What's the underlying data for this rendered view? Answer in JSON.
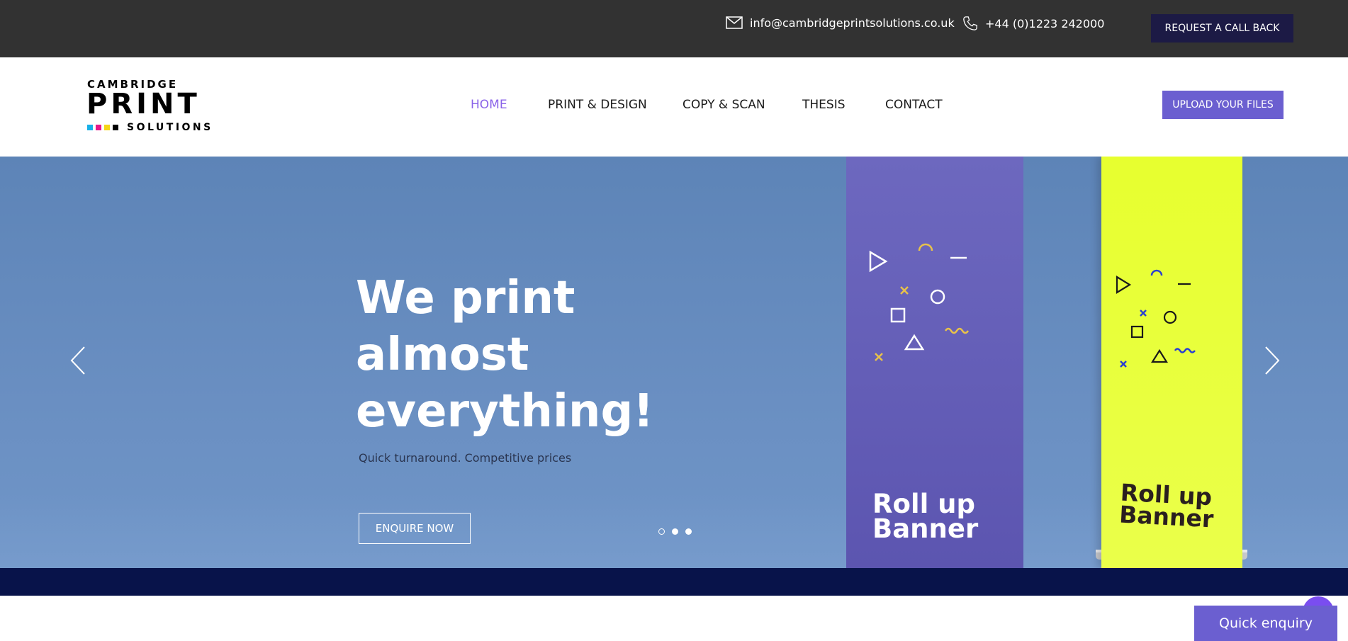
{
  "topbar": {
    "email": "info@cambridgeprintsolutions.co.uk",
    "phone": "+44 (0)1223 242000",
    "callback_label": "REQUEST A CALL BACK",
    "email_icon": "mail-icon",
    "phone_icon": "phone-icon"
  },
  "logo": {
    "top": "CAMBRIDGE",
    "main": "PRINT",
    "bottom": "SOLUTIONS",
    "swatch_colors": [
      "#17b0e8",
      "#e8178a",
      "#f5d616",
      "#000000"
    ]
  },
  "nav": {
    "items": [
      {
        "label": "HOME",
        "active": true
      },
      {
        "label": "PRINT & DESIGN",
        "active": false
      },
      {
        "label": "COPY & SCAN",
        "active": false
      },
      {
        "label": "THESIS",
        "active": false
      },
      {
        "label": "CONTACT",
        "active": false
      }
    ],
    "upload_label": "UPLOAD YOUR FILES"
  },
  "hero": {
    "title_line1": "We print",
    "title_line2": "almost",
    "title_line3": "everything!",
    "subtitle": "Quick turnaround. Competitive prices",
    "cta_label": "ENQUIRE NOW",
    "banner1_line1": "Roll up",
    "banner1_line2": "Banner",
    "banner2_line1": "Roll up",
    "banner2_line2": "Banner",
    "slides_count": 3,
    "active_slide": 1
  },
  "quick_enquiry": {
    "label": "Quick enquiry"
  },
  "colors": {
    "topbar": "#323232",
    "accent_purple": "#6b5fd0",
    "nav_active": "#8a63e8",
    "dark_navy": "#08134a",
    "callback_bg": "#1c1a45"
  }
}
